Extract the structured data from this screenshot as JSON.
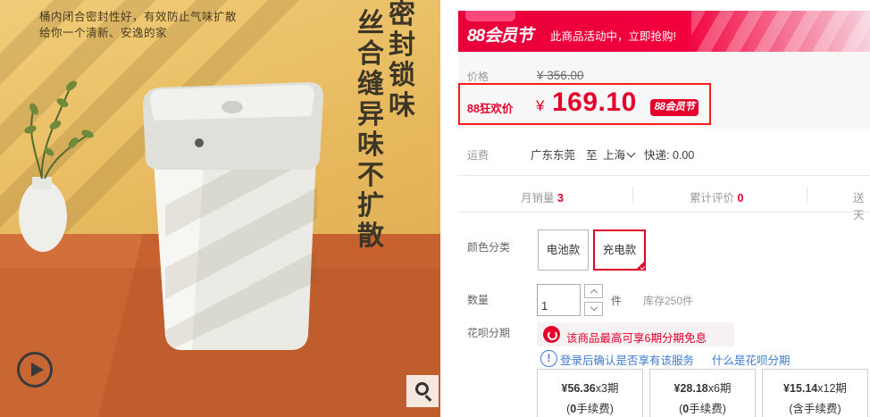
{
  "product_image": {
    "promo_lines": [
      "桶内闭合密封性好，有效防止气味扩散",
      "给你一个清新、安逸的家"
    ],
    "vertical_text_right": "密封锁味",
    "vertical_text_left": "丝合缝 异味不扩散",
    "lid_logo": "◎",
    "play_icon": "play-circle-icon",
    "zoom_icon": "magnifier-icon"
  },
  "banner": {
    "logo": "88会员节",
    "text": "此商品活动中，立即抢购!"
  },
  "price": {
    "label": "价格",
    "original": "¥ 356.00",
    "promo_label": "88狂欢价",
    "currency": "¥",
    "current": "169.10",
    "vip_tag": "88会员节"
  },
  "shipping": {
    "label": "运费",
    "from": "广东东莞",
    "to_prefix": "至",
    "to": "上海",
    "method": "快递: 0.00"
  },
  "stats": [
    {
      "label": "月销量",
      "value": "3"
    },
    {
      "label": "累计评价",
      "value": "0"
    },
    {
      "label": "送天",
      "value": ""
    }
  ],
  "color": {
    "label": "颜色分类",
    "options": [
      {
        "label": "电池款",
        "selected": false
      },
      {
        "label": "充电款",
        "selected": true
      }
    ]
  },
  "quantity": {
    "label": "数量",
    "value": "1",
    "unit": "件",
    "stock": "库存250件"
  },
  "installment": {
    "label": "花呗分期",
    "notice": "该商品最高可享6期分期免息",
    "login_text": "登录后确认是否享有该服务",
    "link": "什么是花呗分期",
    "plans": [
      {
        "amount": "¥56.36",
        "periods": "x3期",
        "fee_prefix": "(",
        "fee_bold": "0",
        "fee_suffix": "手续费)"
      },
      {
        "amount": "¥28.18",
        "periods": "x6期",
        "fee_prefix": "(",
        "fee_bold": "0",
        "fee_suffix": "手续费)"
      },
      {
        "amount": "¥15.14",
        "periods": "x12期",
        "fee_prefix": "(",
        "fee_bold": "",
        "fee_suffix": "含手续费)"
      }
    ]
  },
  "colors": {
    "accent": "#e4002b",
    "link": "#3d7bd6",
    "background_image": "#e7b95e"
  }
}
